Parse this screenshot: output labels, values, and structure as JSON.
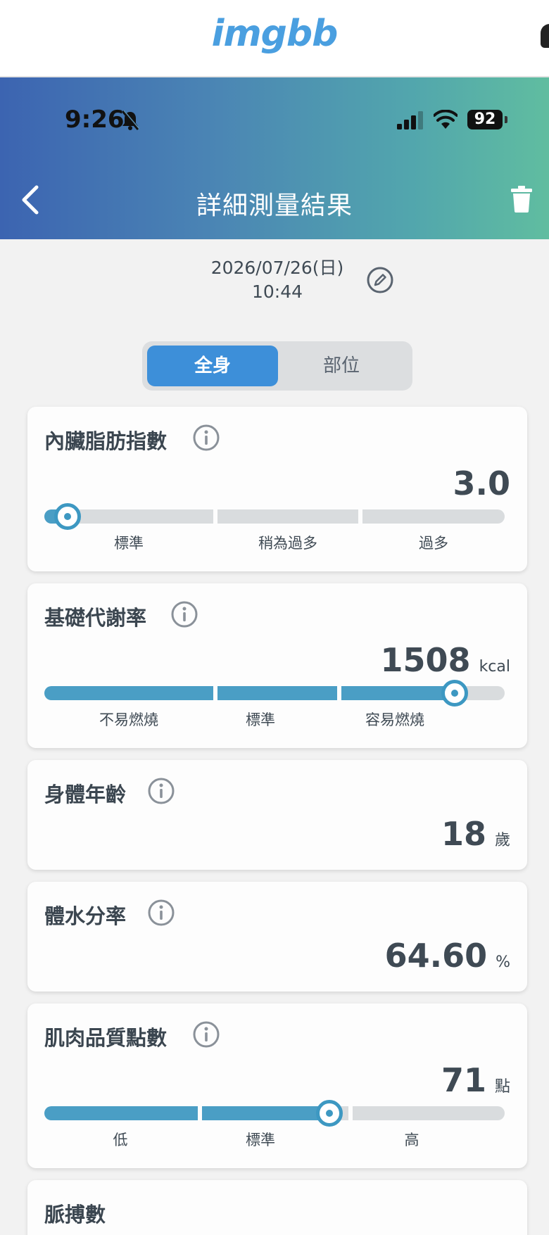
{
  "imgbb": {
    "logo": "imgbb"
  },
  "status_bar": {
    "time": "9:26",
    "battery": "92"
  },
  "header": {
    "title": "詳細測量結果"
  },
  "date": {
    "date": "2026/07/26(日)",
    "time": "10:44"
  },
  "tabs": [
    {
      "label": "全身",
      "active": true
    },
    {
      "label": "部位",
      "active": false
    }
  ],
  "metrics": [
    {
      "title": "內臟脂肪指數",
      "value": "3.0",
      "unit": "",
      "ranges": [
        "標準",
        "稍為過多",
        "過多"
      ],
      "level": 0.03
    },
    {
      "title": "基礎代謝率",
      "value": "1508",
      "unit": "kcal",
      "ranges": [
        "不易燃燒",
        "標準",
        "容易燃燒"
      ],
      "level": 0.89
    },
    {
      "title": "身體年齡",
      "value": "18",
      "unit": "歲"
    },
    {
      "title": "體水分率",
      "value": "64.60",
      "unit": "%"
    },
    {
      "title": "肌肉品質點數",
      "value": "71",
      "unit": "點",
      "ranges": [
        "低",
        "標準",
        "高"
      ],
      "level": 0.62
    },
    {
      "title": "脈搏數"
    }
  ],
  "colors": {
    "accent": "#3d8fd9",
    "bar_fill": "#4a9ec5",
    "bar_empty": "#d9dcde",
    "header_start": "#3c64b1",
    "header_end": "#60bda0"
  }
}
